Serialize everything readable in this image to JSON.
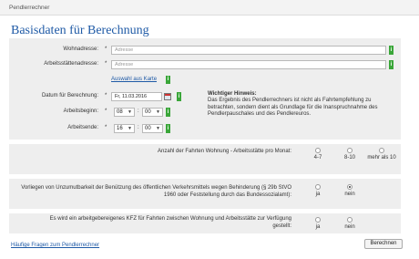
{
  "app": {
    "title": "Pendlerrechner"
  },
  "page": {
    "heading": "Basisdaten für Berechnung"
  },
  "form": {
    "wohnadresse": {
      "label": "Wohnadresse:",
      "placeholder": "Adresse"
    },
    "arbeitsadresse": {
      "label": "Arbeitsstättenadresse:",
      "placeholder": "Adresse"
    },
    "map_link": "Auswahl aus Karte",
    "datum": {
      "label": "Datum für Berechnung:",
      "value": "Fr, 11.03.2016"
    },
    "beginn": {
      "label": "Arbeitsbeginn:",
      "hour": "08",
      "minute": "00"
    },
    "ende": {
      "label": "Arbeitsende:",
      "hour": "16",
      "minute": "00"
    },
    "required_mark": "*",
    "info_mark": "i"
  },
  "hint": {
    "title": "Wichtiger Hinweis:",
    "text": "Das Ergebnis des Pendlerrechners ist nicht als Fahrtempfehlung zu betrachten, sondern dient als Grundlage für die Inanspruchnahme des Pendlerpauschales und des Pendlereuros."
  },
  "questions": {
    "fahrten": {
      "text": "Anzahl der Fahrten Wohnung - Arbeitsstätte pro Monat:",
      "options": [
        "4-7",
        "8-10",
        "mehr als 10"
      ],
      "selected": null
    },
    "unzumutbar": {
      "text": "Vorliegen von Unzumutbarkeit der Benützung des öffentlichen Verkehrsmittels wegen Behinderung (§ 29b StVO 1960 oder Feststellung durch das Bundessozialamt):",
      "options": [
        "ja",
        "nein"
      ],
      "selected": "nein"
    },
    "kfz": {
      "text": "Es wird ein arbeitgebereigenes KFZ für Fahrten zwischen Wohnung und Arbeitsstätte zur Verfügung gestellt:",
      "options": [
        "ja",
        "nein"
      ],
      "selected": null
    }
  },
  "footer": {
    "faq_link": "Häufige Fragen zum Pendlerrechner",
    "submit": "Berechnen"
  },
  "colors": {
    "heading": "#1f5aa6",
    "info_badge": "#3aa639",
    "panel": "#eeeeee"
  }
}
